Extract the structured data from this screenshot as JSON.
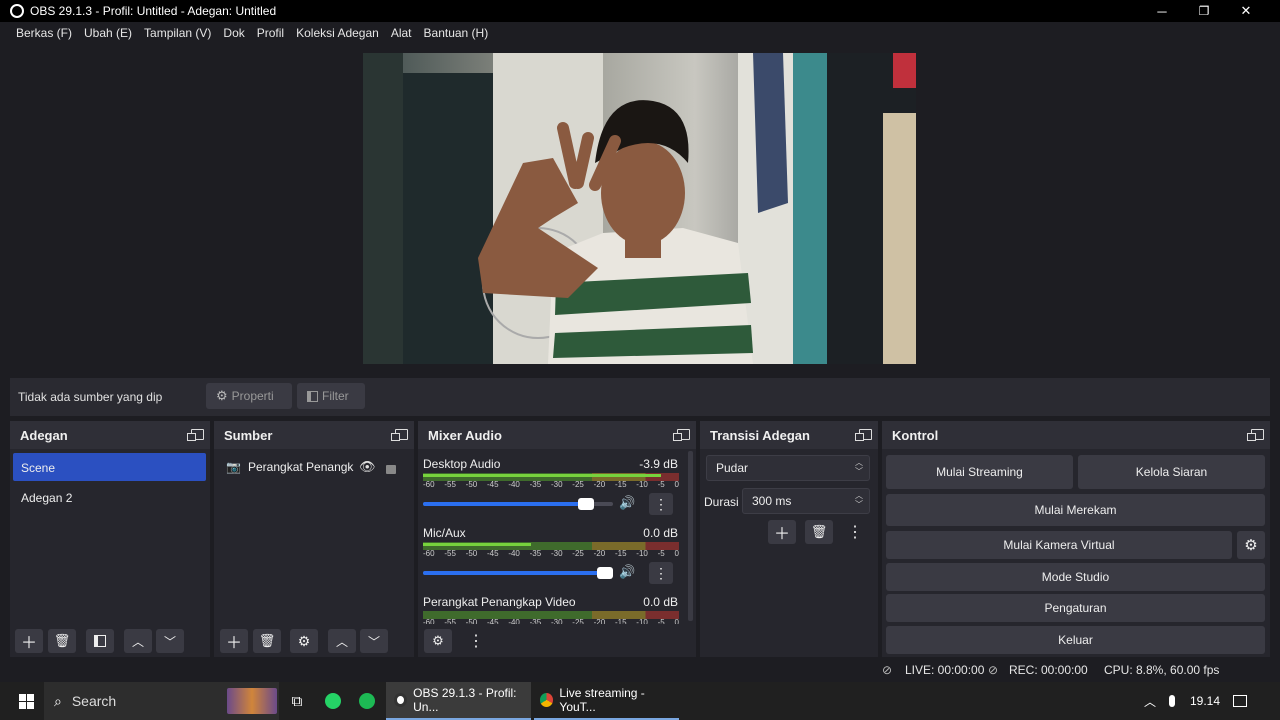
{
  "window": {
    "title": "OBS 29.1.3 - Profil: Untitled - Adegan: Untitled",
    "minimize": "─",
    "maximize": "❐",
    "close": "✕"
  },
  "menu": [
    "Berkas (F)",
    "Ubah (E)",
    "Tampilan (V)",
    "Dok",
    "Profil",
    "Koleksi Adegan",
    "Alat",
    "Bantuan (H)"
  ],
  "source_toolbar": {
    "message": "Tidak ada sumber yang dip",
    "properties": "Properti",
    "filter": "Filter"
  },
  "scenes": {
    "title": "Adegan",
    "items": [
      "Scene",
      "Adegan 2"
    ],
    "selected": "Scene"
  },
  "sources": {
    "title": "Sumber",
    "items": [
      {
        "label": "Perangkat Penangk",
        "icon": "camera-icon"
      }
    ]
  },
  "mixer": {
    "title": "Mixer Audio",
    "scale": [
      "-60",
      "-55",
      "-50",
      "-45",
      "-40",
      "-35",
      "-30",
      "-25",
      "-20",
      "-15",
      "-10",
      "-5",
      "0"
    ],
    "channels": [
      {
        "name": "Desktop Audio",
        "db": "-3.9 dB",
        "volume": 0.9,
        "level": 0.93
      },
      {
        "name": "Mic/Aux",
        "db": "0.0 dB",
        "volume": 1.0,
        "level": 0.42
      },
      {
        "name": "Perangkat Penangkap Video",
        "db": "0.0 dB",
        "volume": 1.0,
        "level": 0.0
      }
    ]
  },
  "transitions": {
    "title": "Transisi Adegan",
    "type": "Pudar",
    "duration_label": "Durasi",
    "duration_value": "300 ms"
  },
  "controls": {
    "title": "Kontrol",
    "start_streaming": "Mulai Streaming",
    "manage_broadcast": "Kelola Siaran",
    "start_recording": "Mulai Merekam",
    "start_virtual_cam": "Mulai Kamera Virtual",
    "studio_mode": "Mode Studio",
    "settings": "Pengaturan",
    "exit": "Keluar"
  },
  "status": {
    "live": "LIVE: 00:00:00",
    "rec": "REC: 00:00:00",
    "cpu": "CPU: 8.8%, 60.00 fps"
  },
  "taskbar": {
    "search": "Search",
    "obs_task": "OBS 29.1.3 - Profil: Un...",
    "chrome_task": "Live streaming - YouT...",
    "time": "19.14"
  },
  "colors": {
    "selection": "#2b50c1",
    "slider": "#2b6ff0",
    "meter_green": "#77d33d"
  }
}
